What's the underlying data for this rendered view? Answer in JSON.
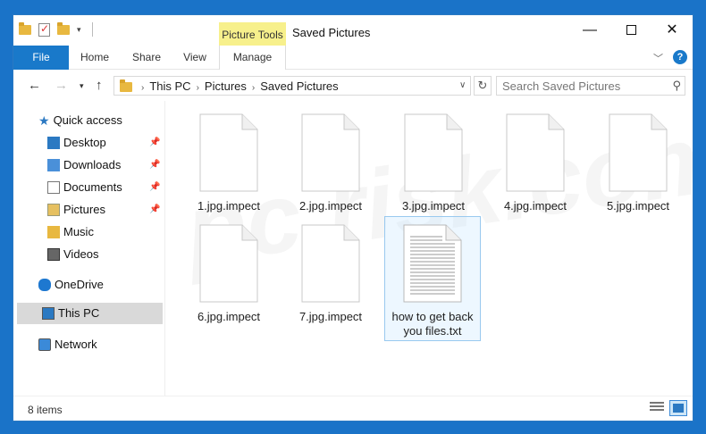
{
  "window": {
    "title": "Saved Pictures",
    "contextual_tab_header": "Picture Tools",
    "minimize_glyph": "—",
    "close_glyph": "✕"
  },
  "ribbon": {
    "tabs": [
      {
        "label": "File"
      },
      {
        "label": "Home"
      },
      {
        "label": "Share"
      },
      {
        "label": "View"
      },
      {
        "label": "Manage"
      }
    ],
    "help_glyph": "?"
  },
  "address": {
    "crumbs": [
      "This PC",
      "Pictures",
      "Saved Pictures"
    ],
    "search_placeholder": "Search Saved Pictures"
  },
  "nav": {
    "quick_access": "Quick access",
    "items": [
      {
        "label": "Desktop",
        "pinned": true
      },
      {
        "label": "Downloads",
        "pinned": true
      },
      {
        "label": "Documents",
        "pinned": true
      },
      {
        "label": "Pictures",
        "pinned": true
      },
      {
        "label": "Music",
        "pinned": false
      },
      {
        "label": "Videos",
        "pinned": false
      }
    ],
    "onedrive": "OneDrive",
    "this_pc": "This PC",
    "network": "Network"
  },
  "files": [
    {
      "name": "1.jpg.impect",
      "type": "blank"
    },
    {
      "name": "2.jpg.impect",
      "type": "blank"
    },
    {
      "name": "3.jpg.impect",
      "type": "blank"
    },
    {
      "name": "4.jpg.impect",
      "type": "blank"
    },
    {
      "name": "5.jpg.impect",
      "type": "blank"
    },
    {
      "name": "6.jpg.impect",
      "type": "blank"
    },
    {
      "name": "7.jpg.impect",
      "type": "blank"
    },
    {
      "name": "how to get back you files.txt",
      "type": "text",
      "selected": true
    }
  ],
  "status": {
    "item_count": "8 items"
  },
  "watermark": "pc risk.com",
  "colors": {
    "accent": "#1979ca",
    "contextual_tab": "#f7f08c",
    "selection": "#cce8ff"
  }
}
